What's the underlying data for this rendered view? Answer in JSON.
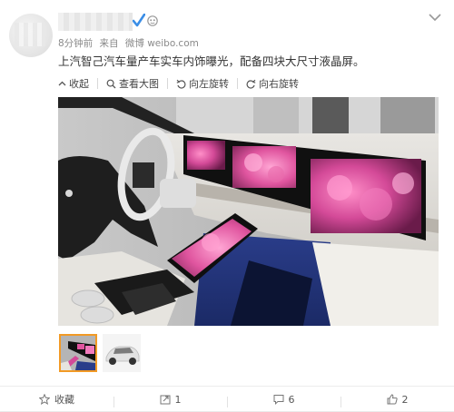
{
  "post": {
    "meta": {
      "time": "8分钟前",
      "source_prefix": "来自",
      "source": "微博 weibo.com"
    },
    "text": "上汽智己汽车量产车实车内饰曝光，配备四块大尺寸液晶屏。",
    "toolbar": {
      "collapse": "收起",
      "view_large": "查看大图",
      "rotate_left": "向左旋转",
      "rotate_right": "向右旋转"
    }
  },
  "actions": {
    "favorite": "收藏",
    "repost_count": "1",
    "comment_count": "6",
    "like_count": "2"
  },
  "colors": {
    "accent_orange": "#f29a25",
    "verified_blue": "#3b8ee6",
    "text_meta": "#8a8a8a"
  },
  "icons": [
    "verified-icon",
    "member-icon",
    "chevron-down-icon",
    "collapse-icon",
    "search-icon",
    "rotate-left-icon",
    "rotate-right-icon",
    "star-icon",
    "repost-icon",
    "comment-icon",
    "like-icon"
  ]
}
